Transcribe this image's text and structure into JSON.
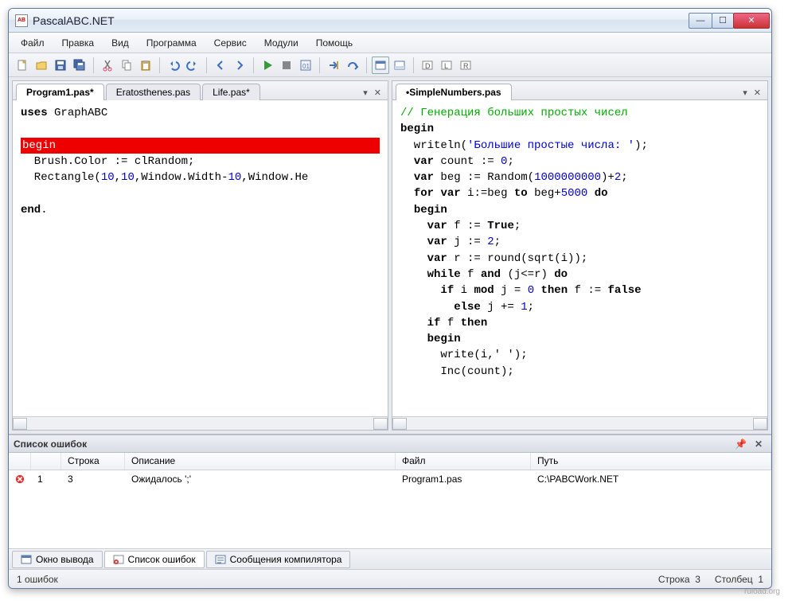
{
  "app": {
    "title": "PascalABC.NET",
    "icon_label": "AB"
  },
  "menu": [
    "Файл",
    "Правка",
    "Вид",
    "Программа",
    "Сервис",
    "Модули",
    "Помощь"
  ],
  "left_pane": {
    "tabs": [
      {
        "label": "Program1.pas*",
        "active": true
      },
      {
        "label": "Eratosthenes.pas",
        "active": false
      },
      {
        "label": "Life.pas*",
        "active": false
      }
    ],
    "code": {
      "line1_pre": "uses",
      "line1_rest": " GraphABC",
      "err": "begin",
      "l3a": "  Brush.Color := clRandom;",
      "l4a": "  Rectangle(",
      "l4b": "10",
      "l4c": ",",
      "l4d": "10",
      "l4e": ",Window.Width-",
      "l4f": "10",
      "l4g": ",Window.He",
      "end": "end",
      "dot": "."
    }
  },
  "right_pane": {
    "tabs": [
      {
        "label": "•SimpleNumbers.pas",
        "active": true
      }
    ],
    "code": {
      "c1": "// Генерация больших простых чисел",
      "kw_begin": "begin",
      "l2a": "  writeln(",
      "l2b": "'Большие простые числа: '",
      "l2c": ");",
      "l3a": "  ",
      "l3kw": "var",
      "l3b": " count := ",
      "l3n": "0",
      "l3c": ";",
      "l4a": "  ",
      "l4kw": "var",
      "l4b": " beg := Random(",
      "l4n": "1000000000",
      "l4c": ")+",
      "l4n2": "2",
      "l4d": ";",
      "l5a": "  ",
      "l5kw1": "for",
      "l5b": " ",
      "l5kw2": "var",
      "l5c": " i:=beg ",
      "l5kw3": "to",
      "l5d": " beg+",
      "l5n": "5000",
      "l5e": " ",
      "l5kw4": "do",
      "l6a": "  ",
      "l6kw": "begin",
      "l7a": "    ",
      "l7kw": "var",
      "l7b": " f := ",
      "l7bool": "True",
      "l7c": ";",
      "l8a": "    ",
      "l8kw": "var",
      "l8b": " j := ",
      "l8n": "2",
      "l8c": ";",
      "l9a": "    ",
      "l9kw": "var",
      "l9b": " r := round(sqrt(i));",
      "l10a": "    ",
      "l10kw": "while",
      "l10b": " f ",
      "l10kw2": "and",
      "l10c": " (j<=r) ",
      "l10kw3": "do",
      "l11a": "      ",
      "l11kw": "if",
      "l11b": " i ",
      "l11kw2": "mod",
      "l11c": " j = ",
      "l11n": "0",
      "l11d": " ",
      "l11kw3": "then",
      "l11e": " f := ",
      "l11bool": "false",
      "l12a": "        ",
      "l12kw": "else",
      "l12b": " j += ",
      "l12n": "1",
      "l12c": ";",
      "l13a": "    ",
      "l13kw": "if",
      "l13b": " f ",
      "l13kw2": "then",
      "l14a": "    ",
      "l14kw": "begin",
      "l15": "      write(i,' ');",
      "l16": "      Inc(count);"
    }
  },
  "errors": {
    "title": "Список ошибок",
    "columns": {
      "n": "",
      "line": "Строка",
      "desc": "Описание",
      "file": "Файл",
      "path": "Путь"
    },
    "rows": [
      {
        "n": "1",
        "line": "3",
        "desc": "Ожидалось ';'",
        "file": "Program1.pas",
        "path": "C:\\PABCWork.NET"
      }
    ]
  },
  "bottom_tabs": [
    {
      "label": "Окно вывода",
      "active": false
    },
    {
      "label": "Список ошибок",
      "active": true
    },
    {
      "label": "Сообщения компилятора",
      "active": false
    }
  ],
  "status": {
    "left": "1 ошибок",
    "line_lbl": "Строка",
    "line": "3",
    "col_lbl": "Столбец",
    "col": "1"
  },
  "watermark": "ruload.org"
}
